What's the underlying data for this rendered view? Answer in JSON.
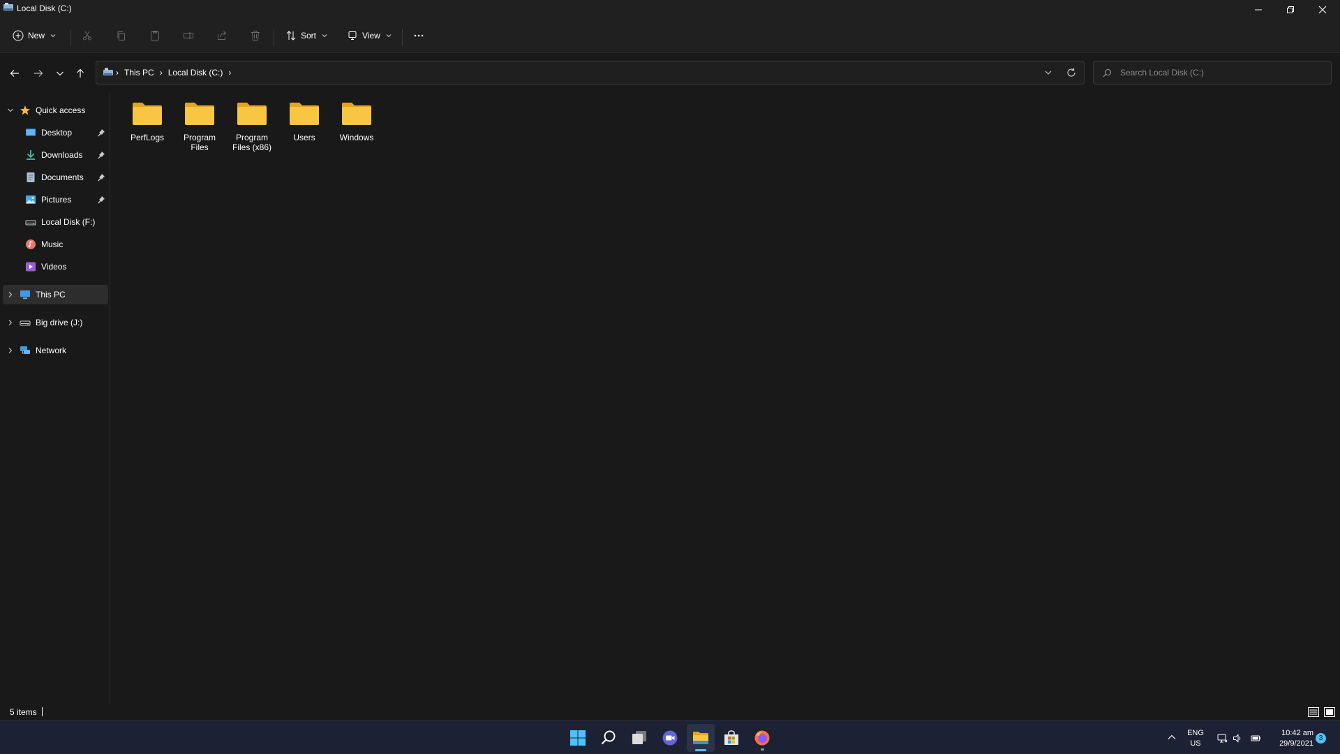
{
  "window": {
    "title": "Local Disk (C:)"
  },
  "toolbar": {
    "new_label": "New",
    "sort_label": "Sort",
    "view_label": "View"
  },
  "address": {
    "crumbs": [
      "This PC",
      "Local Disk (C:)"
    ]
  },
  "search": {
    "placeholder": "Search Local Disk (C:)"
  },
  "sidebar": {
    "quick_access": "Quick access",
    "pinned": [
      {
        "label": "Desktop",
        "icon": "desktop-icon"
      },
      {
        "label": "Downloads",
        "icon": "downloads-icon"
      },
      {
        "label": "Documents",
        "icon": "documents-icon"
      },
      {
        "label": "Pictures",
        "icon": "pictures-icon"
      }
    ],
    "recent": [
      {
        "label": "Local Disk (F:)",
        "icon": "drive-icon"
      },
      {
        "label": "Music",
        "icon": "music-icon"
      },
      {
        "label": "Videos",
        "icon": "videos-icon"
      }
    ],
    "roots": [
      {
        "label": "This PC",
        "icon": "computer-icon"
      },
      {
        "label": "Big drive (J:)",
        "icon": "drive-icon"
      },
      {
        "label": "Network",
        "icon": "network-icon"
      }
    ]
  },
  "content": {
    "items": [
      {
        "label": "PerfLogs"
      },
      {
        "label": "Program Files"
      },
      {
        "label": "Program Files (x86)"
      },
      {
        "label": "Users"
      },
      {
        "label": "Windows"
      }
    ]
  },
  "status": {
    "item_count": "5 items"
  },
  "taskbar": {
    "apps": [
      "start-icon",
      "search-icon",
      "task-view-icon",
      "chat-icon",
      "file-explorer-icon",
      "store-icon",
      "firefox-icon"
    ],
    "lang_line1": "ENG",
    "lang_line2": "US",
    "time": "10:42 am",
    "date": "29/9/2021",
    "notification_count": "3"
  },
  "colors": {
    "accent": "#4cc2ff",
    "folder": "#f8c642",
    "background": "#191919",
    "chrome": "#202020"
  }
}
